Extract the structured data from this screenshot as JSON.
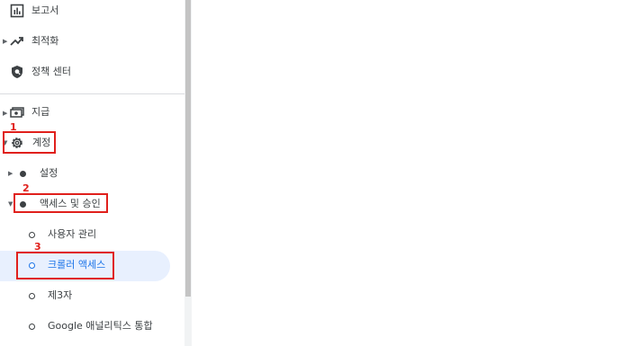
{
  "nav": {
    "reports": {
      "label": "보고서",
      "icon": "bar-chart-icon"
    },
    "optimize": {
      "label": "최적화",
      "icon": "trending-up-icon"
    },
    "policy": {
      "label": "정책 센터",
      "icon": "shield-icon"
    },
    "payments": {
      "label": "지급",
      "icon": "money-icon"
    },
    "account": {
      "label": "계정",
      "icon": "gear-icon"
    },
    "settings": {
      "label": "설정"
    },
    "access": {
      "label": "액세스 및 승인"
    },
    "access_items": [
      {
        "label": "사용자 관리"
      },
      {
        "label": "크롤러 액세스",
        "selected": true
      },
      {
        "label": "제3자"
      },
      {
        "label": "Google 애널리틱스 통합"
      }
    ]
  },
  "annotations": {
    "n1": "1",
    "n2": "2",
    "n3": "3",
    "color": "#e0201c"
  },
  "colors": {
    "selected_bg": "#e8f0fe",
    "selected_text": "#1a73e8"
  }
}
